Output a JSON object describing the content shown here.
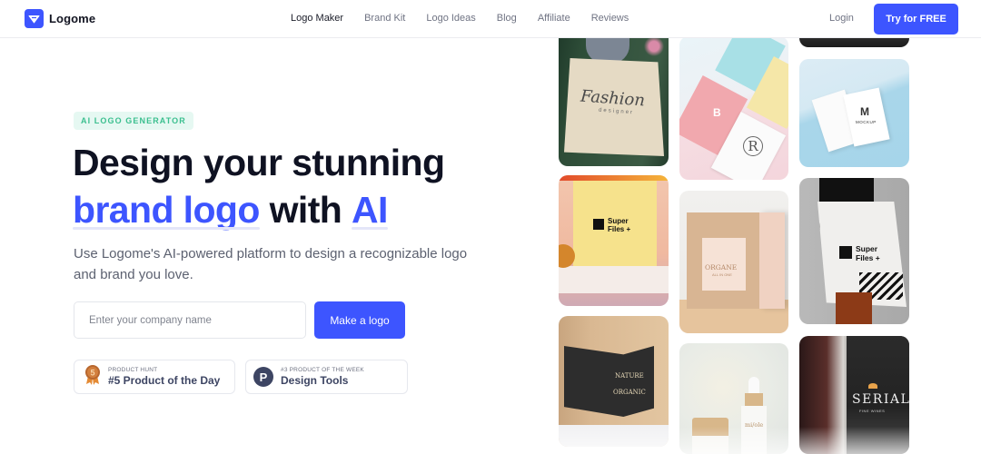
{
  "header": {
    "brand_name": "Logome",
    "brand_color": "#3d55ff",
    "nav": [
      {
        "label": "Logo Maker",
        "active": true
      },
      {
        "label": "Brand Kit",
        "active": false
      },
      {
        "label": "Logo Ideas",
        "active": false
      },
      {
        "label": "Blog",
        "active": false
      },
      {
        "label": "Affiliate",
        "active": false
      },
      {
        "label": "Reviews",
        "active": false
      }
    ],
    "login_label": "Login",
    "cta_label": "Try for FREE"
  },
  "hero": {
    "eyebrow": "AI LOGO GENERATOR",
    "headline_line1": "Design your stunning",
    "headline_accent1": "brand logo",
    "headline_mid": "with",
    "headline_accent2": "AI",
    "subtitle": "Use Logome's AI-powered platform to design a recognizable logo and brand you love.",
    "input_placeholder": "Enter your company name",
    "input_value": "",
    "submit_label": "Make a logo"
  },
  "badges": [
    {
      "icon": "medal-icon",
      "icon_text": "5",
      "small": "PRODUCT HUNT",
      "big": "#5 Product of the Day"
    },
    {
      "icon": "product-hunt-icon",
      "icon_text": "P",
      "small": "#3 PRODUCT OF THE WEEK",
      "big": "Design Tools"
    }
  ],
  "gallery": {
    "tiles": [
      {
        "name": "fashion-tote-mockup",
        "text": "Fashion",
        "subtext": "designer"
      },
      {
        "name": "super-files-box-mockup",
        "text": "Super",
        "subtext": "Files +"
      },
      {
        "name": "nature-organic-box-mockup",
        "text": "NATURE",
        "subtext": "ORGANIC"
      },
      {
        "name": "brand-business-cards-mockup",
        "text": "B",
        "subtext": "R"
      },
      {
        "name": "organe-bag-mockup",
        "text": "ORGANE",
        "subtext": "ALL IN ONE"
      },
      {
        "name": "mi-jole-skincare-mockup",
        "text": "mi/ole",
        "subtext": ""
      },
      {
        "name": "dark-product-mockup",
        "text": "",
        "subtext": ""
      },
      {
        "name": "mockup-business-cards",
        "text": "M",
        "subtext": "MOCKUP"
      },
      {
        "name": "super-files-tote-mockup",
        "text": "Super",
        "subtext": "Files +"
      },
      {
        "name": "serial-wine-bottle-mockup",
        "text": "SERIAL",
        "subtext": "FINE WINES"
      }
    ]
  }
}
